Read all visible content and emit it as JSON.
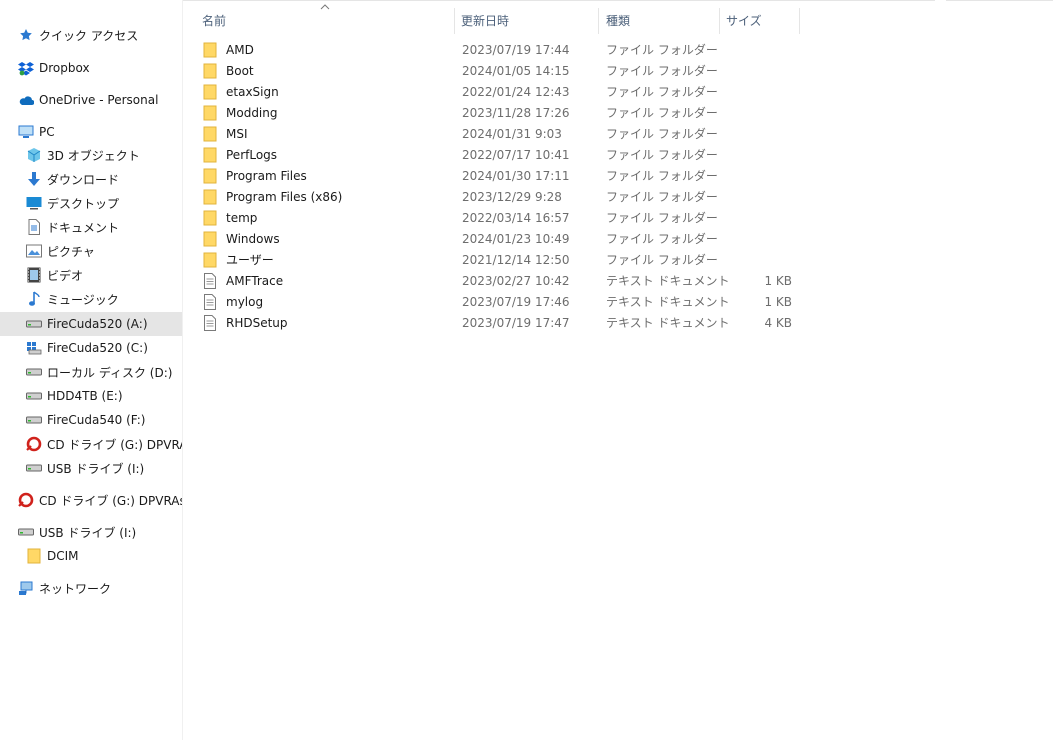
{
  "sidebar": {
    "items": [
      {
        "label": "クイック アクセス",
        "icon": "star-icon",
        "level": 0
      },
      {
        "label": "Dropbox",
        "icon": "dropbox-icon",
        "level": 0
      },
      {
        "label": "OneDrive - Personal",
        "icon": "cloud-icon",
        "level": 0
      },
      {
        "label": "PC",
        "icon": "pc-icon",
        "level": 0
      },
      {
        "label": "3D オブジェクト",
        "icon": "cube-icon",
        "level": 1
      },
      {
        "label": "ダウンロード",
        "icon": "download-icon",
        "level": 1
      },
      {
        "label": "デスクトップ",
        "icon": "desktop-icon",
        "level": 1
      },
      {
        "label": "ドキュメント",
        "icon": "document-icon",
        "level": 1
      },
      {
        "label": "ピクチャ",
        "icon": "pictures-icon",
        "level": 1
      },
      {
        "label": "ビデオ",
        "icon": "video-icon",
        "level": 1
      },
      {
        "label": "ミュージック",
        "icon": "music-icon",
        "level": 1
      },
      {
        "label": "FireCuda520 (A:)",
        "icon": "drive-icon",
        "level": 1,
        "selected": true
      },
      {
        "label": "FireCuda520 (C:)",
        "icon": "windows-drive-icon",
        "level": 1
      },
      {
        "label": "ローカル ディスク (D:)",
        "icon": "drive-icon",
        "level": 1
      },
      {
        "label": "HDD4TB (E:)",
        "icon": "drive-icon",
        "level": 1
      },
      {
        "label": "FireCuda540 (F:)",
        "icon": "drive-icon",
        "level": 1
      },
      {
        "label": "CD ドライブ (G:) DPVRAssistant",
        "icon": "cd-drive-icon",
        "level": 1
      },
      {
        "label": "USB ドライブ (I:)",
        "icon": "drive-icon",
        "level": 1
      },
      {
        "label": "CD ドライブ (G:) DPVRAssistant",
        "icon": "cd-drive-icon",
        "level": 0
      },
      {
        "label": "USB ドライブ (I:)",
        "icon": "drive-icon",
        "level": 0
      },
      {
        "label": "DCIM",
        "icon": "folder-icon",
        "level": 1
      },
      {
        "label": "ネットワーク",
        "icon": "network-icon",
        "level": 0
      }
    ]
  },
  "columns": {
    "name": "名前",
    "date": "更新日時",
    "type": "種類",
    "size": "サイズ"
  },
  "files": [
    {
      "name": "AMD",
      "date": "2023/07/19 17:44",
      "type": "ファイル フォルダー",
      "size": "",
      "icon": "folder-icon"
    },
    {
      "name": "Boot",
      "date": "2024/01/05 14:15",
      "type": "ファイル フォルダー",
      "size": "",
      "icon": "folder-icon"
    },
    {
      "name": "etaxSign",
      "date": "2022/01/24 12:43",
      "type": "ファイル フォルダー",
      "size": "",
      "icon": "folder-icon"
    },
    {
      "name": "Modding",
      "date": "2023/11/28 17:26",
      "type": "ファイル フォルダー",
      "size": "",
      "icon": "folder-icon"
    },
    {
      "name": "MSI",
      "date": "2024/01/31 9:03",
      "type": "ファイル フォルダー",
      "size": "",
      "icon": "folder-icon"
    },
    {
      "name": "PerfLogs",
      "date": "2022/07/17 10:41",
      "type": "ファイル フォルダー",
      "size": "",
      "icon": "folder-icon"
    },
    {
      "name": "Program Files",
      "date": "2024/01/30 17:11",
      "type": "ファイル フォルダー",
      "size": "",
      "icon": "folder-icon"
    },
    {
      "name": "Program Files (x86)",
      "date": "2023/12/29 9:28",
      "type": "ファイル フォルダー",
      "size": "",
      "icon": "folder-icon"
    },
    {
      "name": "temp",
      "date": "2022/03/14 16:57",
      "type": "ファイル フォルダー",
      "size": "",
      "icon": "folder-icon"
    },
    {
      "name": "Windows",
      "date": "2024/01/23 10:49",
      "type": "ファイル フォルダー",
      "size": "",
      "icon": "folder-icon"
    },
    {
      "name": "ユーザー",
      "date": "2021/12/14 12:50",
      "type": "ファイル フォルダー",
      "size": "",
      "icon": "folder-icon"
    },
    {
      "name": "AMFTrace",
      "date": "2023/02/27 10:42",
      "type": "テキスト ドキュメント",
      "size": "1 KB",
      "icon": "text-file-icon"
    },
    {
      "name": "mylog",
      "date": "2023/07/19 17:46",
      "type": "テキスト ドキュメント",
      "size": "1 KB",
      "icon": "text-file-icon"
    },
    {
      "name": "RHDSetup",
      "date": "2023/07/19 17:47",
      "type": "テキスト ドキュメント",
      "size": "4 KB",
      "icon": "text-file-icon"
    }
  ],
  "colors": {
    "folder": "#ffd866",
    "selection": "#e5e5e5",
    "header_text": "#4c607a",
    "accent": "#0078d7"
  }
}
